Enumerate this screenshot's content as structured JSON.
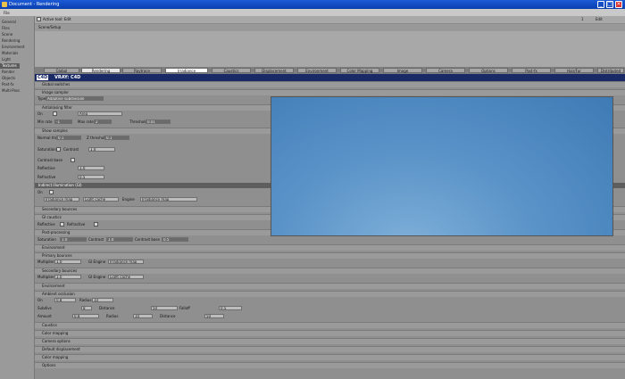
{
  "window": {
    "title": "Document - Rendering",
    "min": "_",
    "max": "□",
    "close": "×"
  },
  "menubar": {
    "file": "File"
  },
  "left_panel": {
    "items": [
      "General",
      "Files",
      "Scene",
      "Rendering",
      "Environment",
      "Materials",
      "Textures",
      "Light",
      "Render",
      "Objects",
      "Post-fx",
      "Multi-Pass"
    ],
    "selected_index": 6
  },
  "top": {
    "row1_label": "Active tool: Edit",
    "row1_right": "1",
    "row1_right2": "Edit",
    "row2_label": "Scene/Setup"
  },
  "tabs": [
    "Global",
    "Rendering",
    "Raytrace",
    "Irradiance",
    "Caustics",
    "Displacement",
    "Environment",
    "Color Mapping",
    "Image",
    "Camera",
    "Options",
    "Post-fx",
    "Hair/Fur",
    "Distributed"
  ],
  "active_tab_index": 1,
  "header": {
    "icon_label": "C4D",
    "title": "VRAY: C4D"
  },
  "sections": {
    "global_switches": "Global switches",
    "image_sampler": "Image sampler",
    "type_label": "Type",
    "type_value": "Adaptive subdivision",
    "antialias": "Antialiasing filter",
    "on_label": "On",
    "filter_value": "Area",
    "size_label": "Size",
    "rate_label": "Rate",
    "min_rate_label": "Min rate",
    "max_rate_label": "Max rate",
    "threshold_label": "Threshold",
    "show_samples": "Show samples",
    "normal_threshold": "Normal threshold",
    "z_threshold": "Z threshold",
    "gi_title": "Indirect illumination (GI)",
    "gi_on": "On",
    "primary_engine": "Irradiance map",
    "secondary_engine": "Light cache",
    "engine_label": "Engine",
    "secondary_bounces": "Secondary bounces",
    "multiplier_label": "Multiplier",
    "gi_caustics": "GI caustics",
    "reflective": "Reflective",
    "refractive": "Refractive",
    "post_processing": "Post-processing",
    "saturation": "Saturation",
    "contrast": "Contrast",
    "contrast_base": "Contrast base",
    "primary": "Primary bounces",
    "gi_engine_label": "GI Engine",
    "gi_engine_value": "Irradiance map",
    "secondary": "Secondary bounces",
    "sec_engine_value": "Light cache",
    "env": "Environment",
    "ao": "Ambient occlusion",
    "on2": "On",
    "amount": "Amount",
    "radius": "Radius",
    "subdivs": "Subdivs",
    "distance": "Distance",
    "falloff": "Falloff",
    "rows": [
      "Caustics",
      "Color mapping",
      "Camera options",
      "Default displacement",
      "Color mapping",
      "Options"
    ]
  },
  "values": {
    "min_rate": "-1",
    "max_rate": "2",
    "threshold": "0.01",
    "normal_thr": "0.1",
    "z_thr": "0.1",
    "multiplier": "1.0",
    "multiplier2": "1.0",
    "saturation": "1.0",
    "contrast": "1.0",
    "contrast_base": "0.5",
    "amount": "0.8",
    "radius": "10",
    "subdivs": "8",
    "distance": "50",
    "falloff": "0.5"
  },
  "colors": {
    "header_bg": "#1a2a66",
    "preview_top": "#3e7ab5",
    "preview_bottom": "#7fb0d8"
  }
}
